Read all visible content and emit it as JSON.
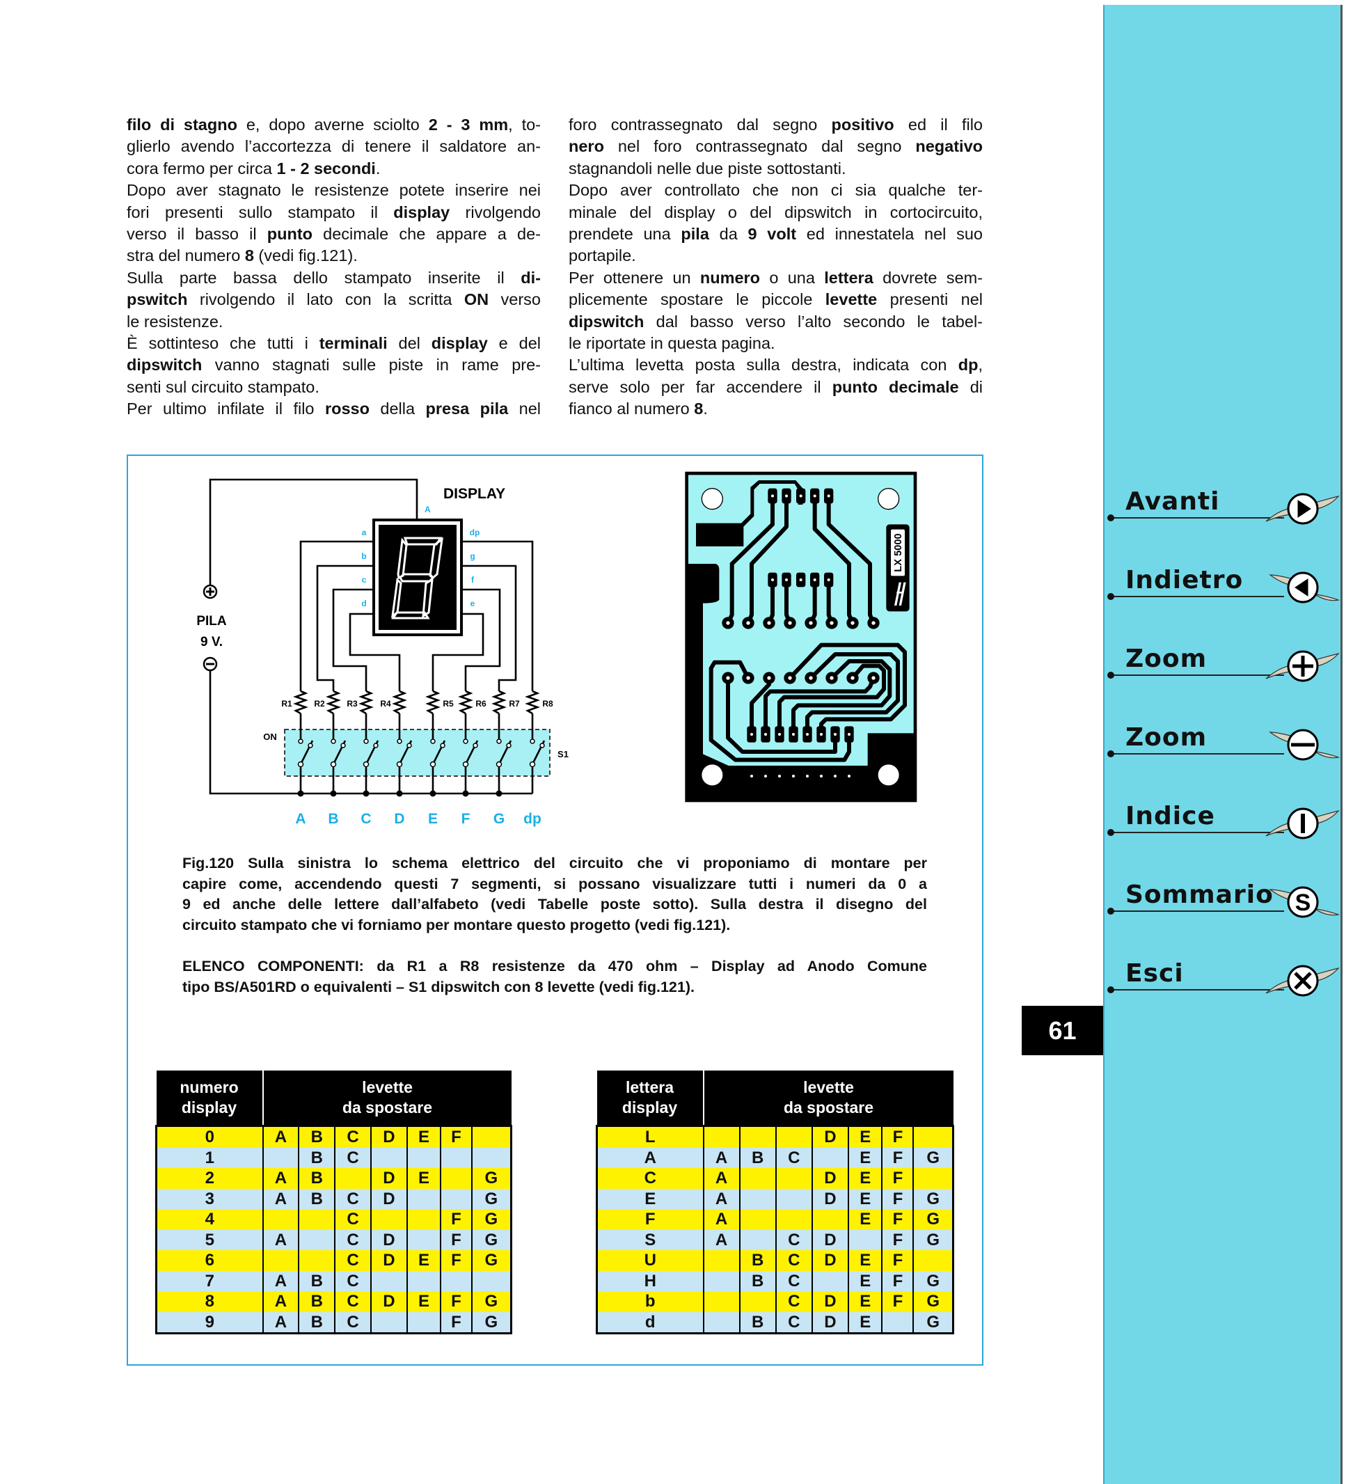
{
  "text": {
    "left": [
      {
        "s": [
          [
            "filo di stagno",
            1
          ],
          [
            " e, dopo averne sciolto ",
            0
          ],
          [
            "2 - 3 mm",
            1
          ],
          [
            ", to-",
            0
          ]
        ]
      },
      {
        "s": [
          [
            "glierlo avendo l’accortezza di tenere il saldatore an-",
            0
          ]
        ]
      },
      {
        "s": [
          [
            "cora fermo per circa ",
            0
          ],
          [
            "1 -  2 secondi",
            1
          ],
          [
            ".",
            0
          ]
        ],
        "end": true
      },
      {
        "s": [
          [
            "Dopo aver stagnato le resistenze potete inserire nei",
            0
          ]
        ]
      },
      {
        "s": [
          [
            "fori presenti sullo stampato il ",
            0
          ],
          [
            "display",
            1
          ],
          [
            " rivolgendo",
            0
          ]
        ]
      },
      {
        "s": [
          [
            "verso il basso il ",
            0
          ],
          [
            "punto",
            1
          ],
          [
            " decimale che appare a de-",
            0
          ]
        ]
      },
      {
        "s": [
          [
            "stra del numero ",
            0
          ],
          [
            "8",
            1
          ],
          [
            " (vedi fig.121).",
            0
          ]
        ],
        "end": true
      },
      {
        "s": [
          [
            "Sulla parte bassa dello stampato inserite il ",
            0
          ],
          [
            "di-",
            1
          ]
        ]
      },
      {
        "s": [
          [
            "pswitch",
            1
          ],
          [
            " rivolgendo il lato con la scritta ",
            0
          ],
          [
            "ON",
            1
          ],
          [
            " verso",
            0
          ]
        ]
      },
      {
        "s": [
          [
            "le resistenze.",
            0
          ]
        ],
        "end": true
      },
      {
        "s": [
          [
            "È sottinteso che tutti i ",
            0
          ],
          [
            "terminali",
            1
          ],
          [
            " del ",
            0
          ],
          [
            "display",
            1
          ],
          [
            " e del",
            0
          ]
        ]
      },
      {
        "s": [
          [
            "dipswitch",
            1
          ],
          [
            " vanno stagnati sulle piste in rame pre-",
            0
          ]
        ]
      },
      {
        "s": [
          [
            "senti sul circuito stampato.",
            0
          ]
        ],
        "end": true
      },
      {
        "s": [
          [
            "Per ultimo infilate il filo ",
            0
          ],
          [
            "rosso",
            1
          ],
          [
            " della ",
            0
          ],
          [
            "presa pila",
            1
          ],
          [
            " nel",
            0
          ]
        ]
      }
    ],
    "right": [
      {
        "s": [
          [
            "foro contrassegnato dal segno ",
            0
          ],
          [
            "positivo",
            1
          ],
          [
            " ed il filo",
            0
          ]
        ]
      },
      {
        "s": [
          [
            "nero",
            1
          ],
          [
            " nel foro contrassegnato dal segno ",
            0
          ],
          [
            "negativo",
            1
          ]
        ]
      },
      {
        "s": [
          [
            "stagnandoli nelle due piste sottostanti.",
            0
          ]
        ],
        "end": true
      },
      {
        "s": [
          [
            "Dopo aver controllato che non ci sia qualche ter-",
            0
          ]
        ]
      },
      {
        "s": [
          [
            "minale del display o del dipswitch in cortocircuito,",
            0
          ]
        ]
      },
      {
        "s": [
          [
            "prendete una ",
            0
          ],
          [
            "pila",
            1
          ],
          [
            " da ",
            0
          ],
          [
            "9 volt",
            1
          ],
          [
            " ed innestatela nel suo",
            0
          ]
        ]
      },
      {
        "s": [
          [
            "portapile.",
            0
          ]
        ],
        "end": true
      },
      {
        "s": [
          [
            "Per ottenere un ",
            0
          ],
          [
            "numero",
            1
          ],
          [
            " o una ",
            0
          ],
          [
            "lettera",
            1
          ],
          [
            " dovrete sem-",
            0
          ]
        ]
      },
      {
        "s": [
          [
            "plicemente spostare le piccole ",
            0
          ],
          [
            "levette",
            1
          ],
          [
            " presenti nel",
            0
          ]
        ]
      },
      {
        "s": [
          [
            "dipswitch",
            1
          ],
          [
            " dal basso verso l’alto secondo le tabel-",
            0
          ]
        ]
      },
      {
        "s": [
          [
            "le riportate in questa pagina.",
            0
          ]
        ],
        "end": true
      },
      {
        "s": [
          [
            "L’ultima levetta posta sulla destra, indicata con ",
            0
          ],
          [
            "dp",
            1
          ],
          [
            ",",
            0
          ]
        ]
      },
      {
        "s": [
          [
            "serve solo per far accendere il ",
            0
          ],
          [
            "punto decimale",
            1
          ],
          [
            " di",
            0
          ]
        ]
      },
      {
        "s": [
          [
            "fianco al numero ",
            0
          ],
          [
            "8",
            1
          ],
          [
            ".",
            0
          ]
        ],
        "end": true
      }
    ]
  },
  "circuit": {
    "display_title": "DISPLAY",
    "anode": "A",
    "pins_left": [
      "a",
      "b",
      "c",
      "d"
    ],
    "pins_right": [
      "dp",
      "g",
      "f",
      "e"
    ],
    "battery_label": "PILA",
    "battery_voltage": "9 V.",
    "resistors": [
      "R1",
      "R2",
      "R3",
      "R4",
      "R5",
      "R6",
      "R7",
      "R8"
    ],
    "on_label": "ON",
    "switch_label": "S1",
    "levers": [
      "A",
      "B",
      "C",
      "D",
      "E",
      "F",
      "G",
      "dp"
    ],
    "label_color": "#1ab0e8"
  },
  "pcb": {
    "label": "LX 5000",
    "logo": "NE"
  },
  "caption": [
    {
      "s": [
        [
          "Fig.120 Sulla sinistra lo schema elettrico del circuito che vi proponiamo di montare per",
          1
        ]
      ]
    },
    {
      "s": [
        [
          "capire come, accendendo questi 7 segmenti, si possano visualizzare tutti i numeri da 0 a",
          1
        ]
      ]
    },
    {
      "s": [
        [
          "9 ed anche delle lettere dall’alfabeto (vedi Tabelle poste sotto). Sulla destra il disegno del",
          1
        ]
      ]
    },
    {
      "s": [
        [
          "circuito stampato che vi forniamo per montare questo progetto (vedi fig.121).",
          1
        ]
      ],
      "end": true
    }
  ],
  "components": [
    {
      "s": [
        [
          "ELENCO COMPONENTI: da R1 a R8 resistenze da 470 ohm – Display ad Anodo Comune",
          1
        ]
      ]
    },
    {
      "s": [
        [
          "tipo BS/A501RD o equivalenti – S1 dipswitch con 8 levette (vedi fig.121).",
          1
        ]
      ],
      "end": true
    }
  ],
  "tables": [
    {
      "header_left": "numero\ndisplay",
      "header_right": "levette\nda spostare",
      "rows": [
        [
          "0",
          "A",
          "B",
          "C",
          "D",
          "E",
          "F",
          ""
        ],
        [
          "1",
          "",
          "B",
          "C",
          "",
          "",
          "",
          ""
        ],
        [
          "2",
          "A",
          "B",
          "",
          "D",
          "E",
          "",
          "G"
        ],
        [
          "3",
          "A",
          "B",
          "C",
          "D",
          "",
          "",
          "G"
        ],
        [
          "4",
          "",
          "",
          "C",
          "",
          "",
          "F",
          "G"
        ],
        [
          "5",
          "A",
          "",
          "C",
          "D",
          "",
          "F",
          "G"
        ],
        [
          "6",
          "",
          "",
          "C",
          "D",
          "E",
          "F",
          "G"
        ],
        [
          "7",
          "A",
          "B",
          "C",
          "",
          "",
          "",
          ""
        ],
        [
          "8",
          "A",
          "B",
          "C",
          "D",
          "E",
          "F",
          "G"
        ],
        [
          "9",
          "A",
          "B",
          "C",
          "",
          "",
          "F",
          "G"
        ]
      ]
    },
    {
      "header_left": "lettera\ndisplay",
      "header_right": "levette\nda spostare",
      "rows": [
        [
          "L",
          "",
          "",
          "",
          "D",
          "E",
          "F",
          ""
        ],
        [
          "A",
          "A",
          "B",
          "C",
          "",
          "E",
          "F",
          "G"
        ],
        [
          "C",
          "A",
          "",
          "",
          "D",
          "E",
          "F",
          ""
        ],
        [
          "E",
          "A",
          "",
          "",
          "D",
          "E",
          "F",
          "G"
        ],
        [
          "F",
          "A",
          "",
          "",
          "",
          "E",
          "F",
          "G"
        ],
        [
          "S",
          "A",
          "",
          "C",
          "D",
          "",
          "F",
          "G"
        ],
        [
          "U",
          "",
          "B",
          "C",
          "D",
          "E",
          "F",
          ""
        ],
        [
          "H",
          "",
          "B",
          "C",
          "",
          "E",
          "F",
          "G"
        ],
        [
          "b",
          "",
          "",
          "C",
          "D",
          "E",
          "F",
          "G"
        ],
        [
          "d",
          "",
          "B",
          "C",
          "D",
          "E",
          "",
          "G"
        ]
      ]
    }
  ],
  "nav": {
    "items": [
      {
        "label": "Avanti",
        "icon": "arrow-right-icon",
        "glyph": ""
      },
      {
        "label": "Indietro",
        "icon": "arrow-left-icon",
        "glyph": ""
      },
      {
        "label": "Zoom",
        "icon": "zoom-in-icon",
        "glyph": ""
      },
      {
        "label": "Zoom",
        "icon": "zoom-out-icon",
        "glyph": ""
      },
      {
        "label": "Indice",
        "icon": "index-icon",
        "glyph": ""
      },
      {
        "label": "Sommario",
        "icon": "summary-icon",
        "glyph": "S"
      },
      {
        "label": "Esci",
        "icon": "exit-icon",
        "glyph": ""
      }
    ],
    "background": "#72d8e8"
  },
  "page_number": "61"
}
